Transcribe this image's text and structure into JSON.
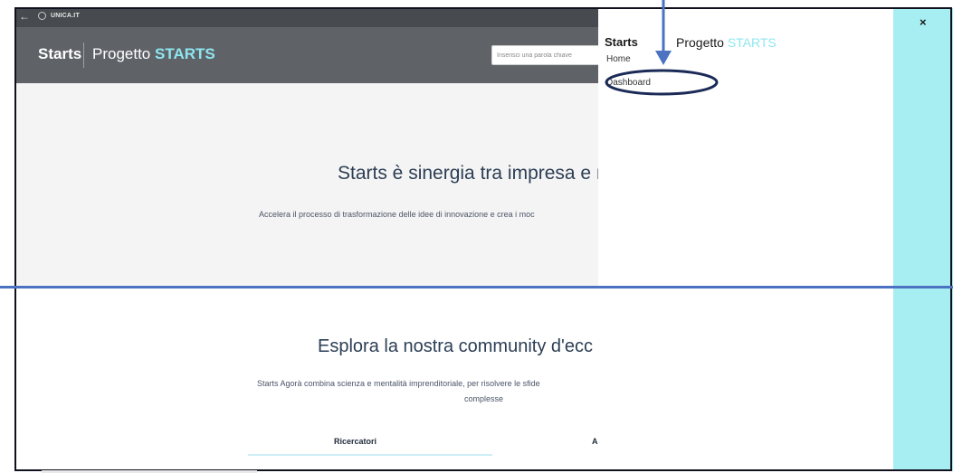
{
  "topbar": {
    "back_icon": "←",
    "org_name": "UNICA.IT"
  },
  "header": {
    "brand": "Starts",
    "project_prefix": "Progetto",
    "project_accent": "STARTS",
    "search_placeholder": "Inserisci una parola chiave"
  },
  "hero": {
    "title": "Starts è sinergia tra impresa e ri",
    "subtitle": "Accelera il processo di trasformazione delle idee di innovazione e crea i moc"
  },
  "community": {
    "title": "Esplora la nostra community d'ecc",
    "description_line1": "Starts Agorà combina scienza e mentalità imprenditoriale, per risolvere le sfide",
    "description_line2": "complesse",
    "tabs": [
      "Ricercatori",
      "A"
    ]
  },
  "drawer": {
    "brand": "Starts",
    "project_prefix": "Progetto",
    "project_accent": "STARTS",
    "menu": [
      "Home",
      "Dashboard"
    ],
    "close_icon": "×"
  },
  "colors": {
    "accent": "#8ee6f0",
    "header_bg": "#5f6368",
    "topbar_bg": "#474b50",
    "drawer_side": "#a7eef3",
    "annotation_blue": "#4b73c1",
    "annotation_navy": "#1b2a57"
  }
}
